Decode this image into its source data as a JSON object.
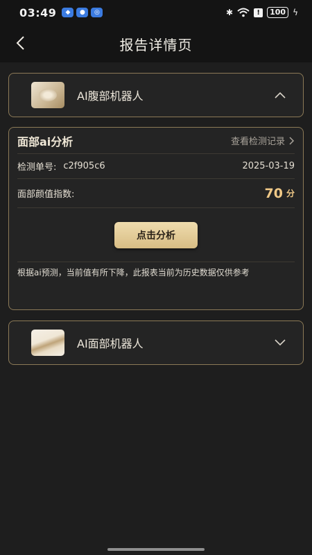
{
  "status_bar": {
    "time": "03:49",
    "battery": "100",
    "apps": [
      "app-icon-1",
      "app-icon-2",
      "app-icon-3"
    ]
  },
  "header": {
    "title": "报告详情页"
  },
  "robot_card_1": {
    "name": "AI腹部机器人",
    "expanded": true
  },
  "analysis": {
    "title": "面部ai分析",
    "record_link": "查看检测记录",
    "order_label": "检测单号:",
    "order_no": "c2f905c6",
    "date": "2025-03-19",
    "score_label": "面部颜值指数:",
    "score": "70",
    "score_unit": "分",
    "button": "点击分析",
    "note": "根据ai预测，当前值有所下降，此报表当前为历史数据仅供参考"
  },
  "robot_card_2": {
    "name": "AI面部机器人",
    "expanded": false
  },
  "colors": {
    "accent": "#f0c987",
    "border": "#8c7a57",
    "button": "#e3c994"
  }
}
